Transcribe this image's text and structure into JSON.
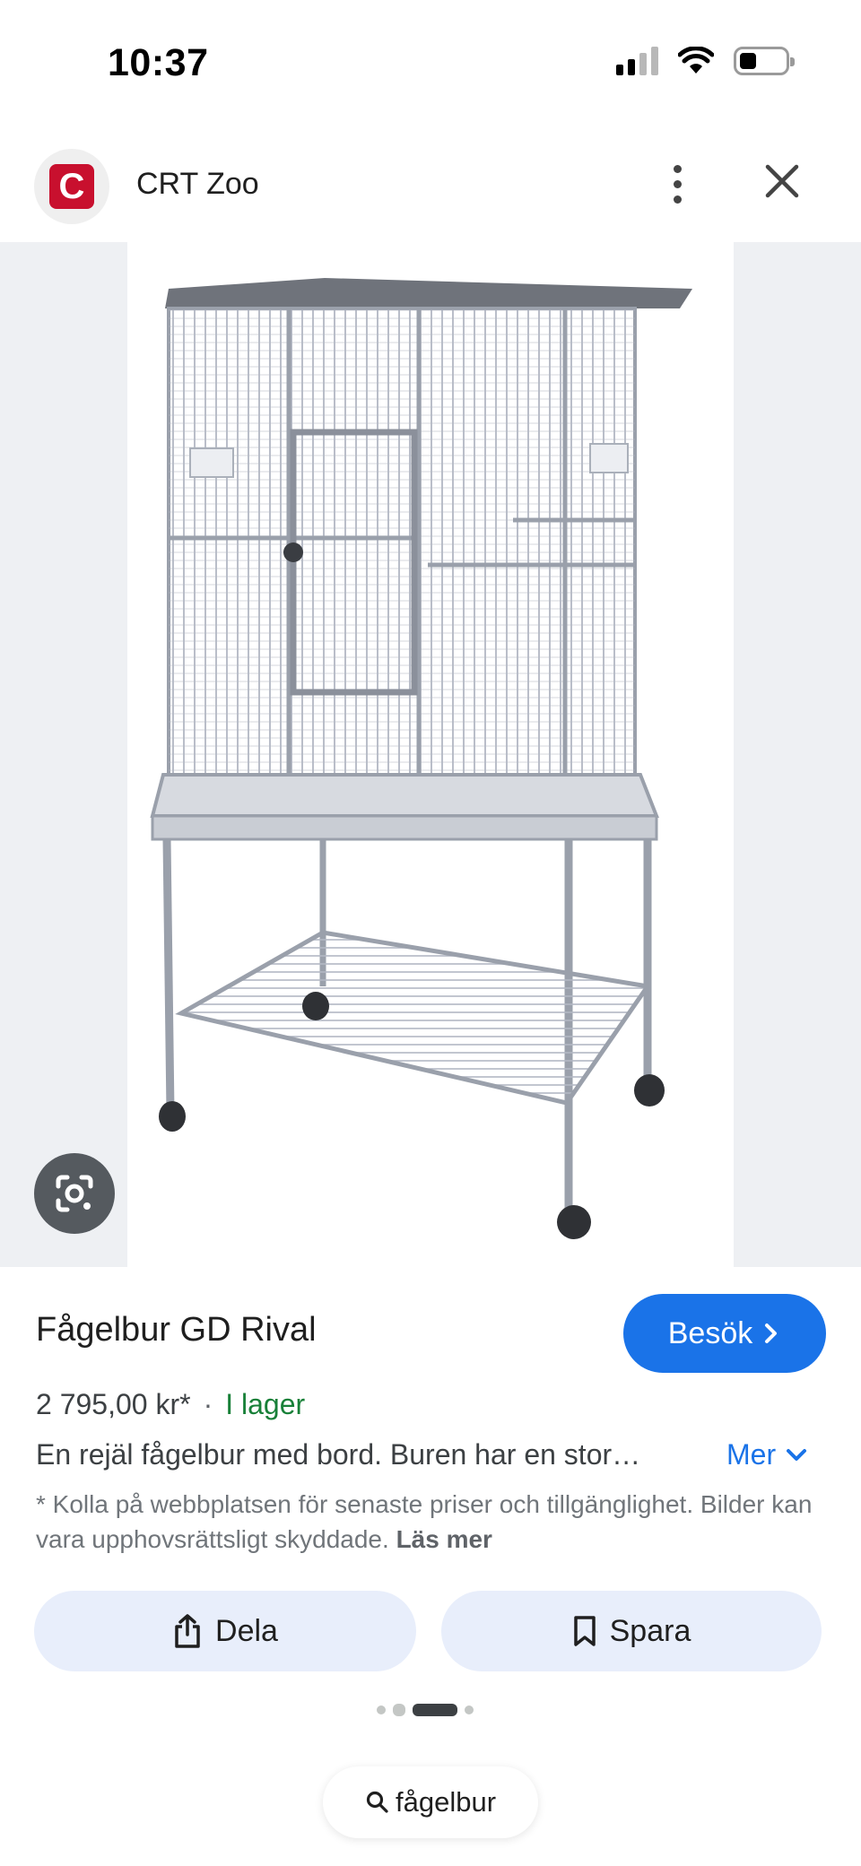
{
  "status_bar": {
    "time": "10:37",
    "icons": [
      "signal-icon",
      "wifi-icon",
      "battery-icon"
    ]
  },
  "header": {
    "site_logo_letter": "C",
    "site_name": "CRT Zoo",
    "icons": [
      "more-vert-icon",
      "close-icon"
    ]
  },
  "image": {
    "subject": "bird-cage-with-stand",
    "lens_icon": "google-lens-icon"
  },
  "product": {
    "title": "Fågelbur GD Rival",
    "visit_label": "Besök",
    "price": "2 795,00 kr*",
    "separator": "·",
    "availability": "I lager",
    "description": "En rejäl fågelbur med bord. Buren har en stor…",
    "more_label": "Mer",
    "disclaimer": "* Kolla på webbplatsen för senaste priser och tillgänglighet. Bilder kan vara upphovsrättsligt skyddade.",
    "read_more_label": "Läs mer"
  },
  "actions": {
    "share_label": "Dela",
    "save_label": "Spara"
  },
  "pager": {
    "total": 4,
    "active_index": 2
  },
  "search": {
    "query": "fågelbur"
  },
  "colors": {
    "accent": "#1a73e8",
    "in_stock": "#188038",
    "brand_logo": "#c8102e",
    "chip_bg": "#e8eefb"
  }
}
